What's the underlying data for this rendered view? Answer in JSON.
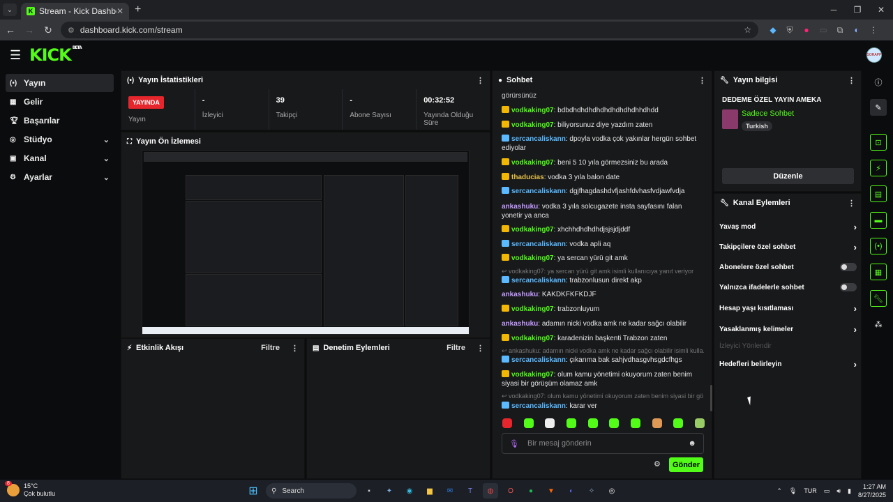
{
  "browser": {
    "tab_title": "Stream - Kick Dashboard",
    "url": "dashboard.kick.com/stream"
  },
  "app": {
    "logo": "KICK",
    "logo_badge": "BETA",
    "avatar_label": "SORAPP"
  },
  "sidebar": {
    "items": [
      {
        "label": "Yayın",
        "icon": "broadcast-icon"
      },
      {
        "label": "Gelir",
        "icon": "revenue-icon"
      },
      {
        "label": "Başarılar",
        "icon": "trophy-icon"
      },
      {
        "label": "Stüdyo",
        "icon": "studio-icon"
      },
      {
        "label": "Kanal",
        "icon": "channel-icon"
      },
      {
        "label": "Ayarlar",
        "icon": "gear-icon"
      }
    ]
  },
  "stats": {
    "title": "Yayın İstatistikleri",
    "live_badge": "YAYINDA",
    "stream_label": "Yayın",
    "viewers_value": "-",
    "viewers_label": "İzleyici",
    "followers_value": "39",
    "followers_label": "Takipçi",
    "subs_value": "-",
    "subs_label": "Abone Sayısı",
    "uptime_value": "00:32:52",
    "uptime_label": "Yayında Olduğu Süre"
  },
  "preview": {
    "title": "Yayın Ön İzlemesi"
  },
  "activity": {
    "title": "Etkinlik Akışı",
    "filter": "Filtre"
  },
  "moderation": {
    "title": "Denetim Eylemleri",
    "filter": "Filtre"
  },
  "chat": {
    "title": "Sohbet",
    "top_fragment": "görürsünüz",
    "messages": [
      {
        "user": "vodkaking07",
        "color": "#53fc18",
        "text": "bdbdhdhdhdhdhdhdhdhdhhdhdd",
        "badge": "crown"
      },
      {
        "user": "vodkaking07",
        "color": "#53fc18",
        "text": "biliyorsunuz diye yazdım zaten",
        "badge": "crown"
      },
      {
        "user": "sercancaliskann",
        "color": "#5ab9ff",
        "text": "dpoyla vodka çok yakınlar hergün sohbet ediyolar",
        "badge": "sword"
      },
      {
        "user": "vodkaking07",
        "color": "#53fc18",
        "text": "beni 5 10 yıla görmezsiniz bu arada",
        "badge": "crown"
      },
      {
        "user": "thaducias",
        "color": "#e6c14a",
        "text": "vodka 3 yıla balon date",
        "badge": "crown"
      },
      {
        "user": "sercancaliskann",
        "color": "#5ab9ff",
        "text": "dgjfhagdashdvfjashfdvhasfvdjawfvdja",
        "badge": "sword"
      },
      {
        "user": "ankashuku",
        "color": "#c39bff",
        "text": "vodka 3 yıla solcugazete insta sayfasını falan yonetir ya anca",
        "badge": ""
      },
      {
        "user": "vodkaking07",
        "color": "#53fc18",
        "text": "xhchhdhdhdhdjsjsjdjddf",
        "badge": "crown"
      },
      {
        "user": "sercancaliskann",
        "color": "#5ab9ff",
        "text": "vodka apli aq",
        "badge": "sword"
      },
      {
        "user": "vodkaking07",
        "color": "#53fc18",
        "text": "ya sercan yürü git amk",
        "badge": "crown"
      },
      {
        "user": "sercancaliskann",
        "color": "#5ab9ff",
        "text": "trabzonlusun direkt akp",
        "badge": "sword"
      },
      {
        "user": "ankashuku",
        "color": "#c39bff",
        "text": "KAKDKFKFKDJF",
        "badge": ""
      },
      {
        "user": "vodkaking07",
        "color": "#53fc18",
        "text": "trabzonluyum",
        "badge": "crown"
      },
      {
        "user": "ankashuku",
        "color": "#c39bff",
        "text": "adamın nicki vodka amk ne kadar sağcı olabilir",
        "badge": ""
      },
      {
        "user": "vodkaking07",
        "color": "#53fc18",
        "text": "karadenizin başkenti Trabzon zaten",
        "badge": "crown"
      },
      {
        "user": "sercancaliskann",
        "color": "#5ab9ff",
        "text": "çıkarıma bak sahjvdhasgvhsgdcfhgs",
        "badge": "sword"
      },
      {
        "user": "vodkaking07",
        "color": "#53fc18",
        "text": "olum kamu yönetimi okuyorum zaten benim siyasi bir görüşüm olamaz amk",
        "badge": "crown"
      },
      {
        "user": "sercancaliskann",
        "color": "#5ab9ff",
        "text": "karar ver",
        "badge": "sword"
      }
    ],
    "replies": [
      "vodkaking07: ya sercan yürü git amk isimli kullanıcıya yanıt veriyor",
      "ankashuku: adamın nicki vodka amk ne kadar sağcı olabilir isimli kulla...",
      "vodkaking07: olum kamu yönetimi okuyorum zaten benim siyasi bir gö..."
    ],
    "input_placeholder": "Bir mesaj gönderin",
    "send_label": "Gönder"
  },
  "stream_info": {
    "title": "Yayın bilgisi",
    "stream_title": "DEDEME ÖZEL YAYIN AMEKA",
    "category": "Sadece Sohbet",
    "tag": "Turkish",
    "edit_label": "Düzenle"
  },
  "channel_actions": {
    "title": "Kanal Eylemleri",
    "items": [
      {
        "label": "Yavaş mod",
        "control": "chevron"
      },
      {
        "label": "Takipçilere özel sohbet",
        "control": "chevron"
      },
      {
        "label": "Abonelere özel sohbet",
        "control": "toggle"
      },
      {
        "label": "Yalnızca ifadelerle sohbet",
        "control": "toggle"
      },
      {
        "label": "Hesap yaşı kısıtlaması",
        "control": "chevron"
      },
      {
        "label": "Yasaklanmış kelimeler",
        "control": "chevron"
      },
      {
        "label": "İzleyici Yönlendir",
        "control": "none"
      },
      {
        "label": "Hedefleri belirleyin",
        "control": "chevron"
      }
    ]
  },
  "taskbar": {
    "temp": "15°C",
    "weather": "Çok bulutlu",
    "weather_badge": "8",
    "search": "Search",
    "lang": "TUR",
    "time": "1:27 AM",
    "date": "8/27/2025"
  },
  "colors": {
    "accent": "#53fc18",
    "live": "#e5262c",
    "bg": "#0b0c0d",
    "panel": "#18191b"
  }
}
